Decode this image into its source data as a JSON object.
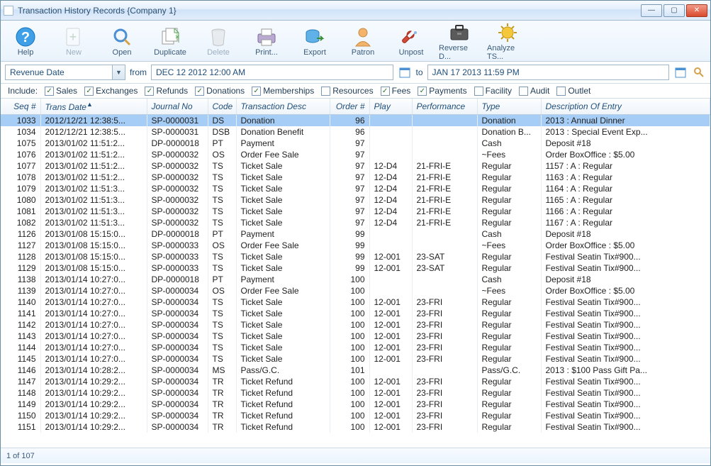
{
  "window": {
    "title": "Transaction History Records {Company 1}"
  },
  "toolbar": {
    "help": "Help",
    "new": "New",
    "open": "Open",
    "duplicate": "Duplicate",
    "delete": "Delete",
    "print": "Print...",
    "export": "Export",
    "patron": "Patron",
    "unpost": "Unpost",
    "reverse": "Reverse D...",
    "analyze": "Analyze TS..."
  },
  "filter": {
    "field": "Revenue Date",
    "from_label": "from",
    "from_value": "DEC 12 2012 12:00 AM",
    "to_label": "to",
    "to_value": "JAN 17 2013 11:59 PM"
  },
  "include": {
    "label": "Include:",
    "sales": "Sales",
    "exchanges": "Exchanges",
    "refunds": "Refunds",
    "donations": "Donations",
    "memberships": "Memberships",
    "resources": "Resources",
    "fees": "Fees",
    "payments": "Payments",
    "facility": "Facility",
    "audit": "Audit",
    "outlet": "Outlet"
  },
  "columns": {
    "seq": "Seq #",
    "trans_date": "Trans Date",
    "journal": "Journal No",
    "code": "Code",
    "desc": "Transaction Desc",
    "order": "Order #",
    "play": "Play",
    "perf": "Performance",
    "type": "Type",
    "entry": "Description Of Entry"
  },
  "status": "1 of 107",
  "rows": [
    {
      "seq": "1033",
      "date": "2012/12/21 12:38:5...",
      "journal": "SP-0000031",
      "code": "DS",
      "desc": "Donation",
      "order": "96",
      "play": "",
      "perf": "",
      "type": "Donation",
      "entry": "2013 : Annual Dinner",
      "selected": true
    },
    {
      "seq": "1034",
      "date": "2012/12/21 12:38:5...",
      "journal": "SP-0000031",
      "code": "DSB",
      "desc": "Donation Benefit",
      "order": "96",
      "play": "",
      "perf": "",
      "type": "Donation B...",
      "entry": "2013 : Special Event Exp..."
    },
    {
      "seq": "1075",
      "date": "2013/01/02 11:51:2...",
      "journal": "DP-0000018",
      "code": "PT",
      "desc": "Payment",
      "order": "97",
      "play": "",
      "perf": "",
      "type": "Cash",
      "entry": "Deposit #18"
    },
    {
      "seq": "1076",
      "date": "2013/01/02 11:51:2...",
      "journal": "SP-0000032",
      "code": "OS",
      "desc": "Order Fee Sale",
      "order": "97",
      "play": "",
      "perf": "",
      "type": "~Fees",
      "entry": "Order BoxOffice : $5.00"
    },
    {
      "seq": "1077",
      "date": "2013/01/02 11:51:2...",
      "journal": "SP-0000032",
      "code": "TS",
      "desc": "Ticket Sale",
      "order": "97",
      "play": "12-D4",
      "perf": "21-FRI-E",
      "type": "Regular",
      "entry": "1157 : A : Regular"
    },
    {
      "seq": "1078",
      "date": "2013/01/02 11:51:2...",
      "journal": "SP-0000032",
      "code": "TS",
      "desc": "Ticket Sale",
      "order": "97",
      "play": "12-D4",
      "perf": "21-FRI-E",
      "type": "Regular",
      "entry": "1163 : A : Regular"
    },
    {
      "seq": "1079",
      "date": "2013/01/02 11:51:3...",
      "journal": "SP-0000032",
      "code": "TS",
      "desc": "Ticket Sale",
      "order": "97",
      "play": "12-D4",
      "perf": "21-FRI-E",
      "type": "Regular",
      "entry": "1164 : A : Regular"
    },
    {
      "seq": "1080",
      "date": "2013/01/02 11:51:3...",
      "journal": "SP-0000032",
      "code": "TS",
      "desc": "Ticket Sale",
      "order": "97",
      "play": "12-D4",
      "perf": "21-FRI-E",
      "type": "Regular",
      "entry": "1165 : A : Regular"
    },
    {
      "seq": "1081",
      "date": "2013/01/02 11:51:3...",
      "journal": "SP-0000032",
      "code": "TS",
      "desc": "Ticket Sale",
      "order": "97",
      "play": "12-D4",
      "perf": "21-FRI-E",
      "type": "Regular",
      "entry": "1166 : A : Regular"
    },
    {
      "seq": "1082",
      "date": "2013/01/02 11:51:3...",
      "journal": "SP-0000032",
      "code": "TS",
      "desc": "Ticket Sale",
      "order": "97",
      "play": "12-D4",
      "perf": "21-FRI-E",
      "type": "Regular",
      "entry": "1167 : A : Regular"
    },
    {
      "seq": "1126",
      "date": "2013/01/08 15:15:0...",
      "journal": "DP-0000018",
      "code": "PT",
      "desc": "Payment",
      "order": "99",
      "play": "",
      "perf": "",
      "type": "Cash",
      "entry": "Deposit #18"
    },
    {
      "seq": "1127",
      "date": "2013/01/08 15:15:0...",
      "journal": "SP-0000033",
      "code": "OS",
      "desc": "Order Fee Sale",
      "order": "99",
      "play": "",
      "perf": "",
      "type": "~Fees",
      "entry": "Order BoxOffice : $5.00"
    },
    {
      "seq": "1128",
      "date": "2013/01/08 15:15:0...",
      "journal": "SP-0000033",
      "code": "TS",
      "desc": "Ticket Sale",
      "order": "99",
      "play": "12-001",
      "perf": "23-SAT",
      "type": "Regular",
      "entry": "Festival Seatin Tix#900..."
    },
    {
      "seq": "1129",
      "date": "2013/01/08 15:15:0...",
      "journal": "SP-0000033",
      "code": "TS",
      "desc": "Ticket Sale",
      "order": "99",
      "play": "12-001",
      "perf": "23-SAT",
      "type": "Regular",
      "entry": "Festival Seatin Tix#900..."
    },
    {
      "seq": "1138",
      "date": "2013/01/14 10:27:0...",
      "journal": "DP-0000018",
      "code": "PT",
      "desc": "Payment",
      "order": "100",
      "play": "",
      "perf": "",
      "type": "Cash",
      "entry": "Deposit #18"
    },
    {
      "seq": "1139",
      "date": "2013/01/14 10:27:0...",
      "journal": "SP-0000034",
      "code": "OS",
      "desc": "Order Fee Sale",
      "order": "100",
      "play": "",
      "perf": "",
      "type": "~Fees",
      "entry": "Order BoxOffice : $5.00"
    },
    {
      "seq": "1140",
      "date": "2013/01/14 10:27:0...",
      "journal": "SP-0000034",
      "code": "TS",
      "desc": "Ticket Sale",
      "order": "100",
      "play": "12-001",
      "perf": "23-FRI",
      "type": "Regular",
      "entry": "Festival Seatin Tix#900..."
    },
    {
      "seq": "1141",
      "date": "2013/01/14 10:27:0...",
      "journal": "SP-0000034",
      "code": "TS",
      "desc": "Ticket Sale",
      "order": "100",
      "play": "12-001",
      "perf": "23-FRI",
      "type": "Regular",
      "entry": "Festival Seatin Tix#900..."
    },
    {
      "seq": "1142",
      "date": "2013/01/14 10:27:0...",
      "journal": "SP-0000034",
      "code": "TS",
      "desc": "Ticket Sale",
      "order": "100",
      "play": "12-001",
      "perf": "23-FRI",
      "type": "Regular",
      "entry": "Festival Seatin Tix#900..."
    },
    {
      "seq": "1143",
      "date": "2013/01/14 10:27:0...",
      "journal": "SP-0000034",
      "code": "TS",
      "desc": "Ticket Sale",
      "order": "100",
      "play": "12-001",
      "perf": "23-FRI",
      "type": "Regular",
      "entry": "Festival Seatin Tix#900..."
    },
    {
      "seq": "1144",
      "date": "2013/01/14 10:27:0...",
      "journal": "SP-0000034",
      "code": "TS",
      "desc": "Ticket Sale",
      "order": "100",
      "play": "12-001",
      "perf": "23-FRI",
      "type": "Regular",
      "entry": "Festival Seatin Tix#900..."
    },
    {
      "seq": "1145",
      "date": "2013/01/14 10:27:0...",
      "journal": "SP-0000034",
      "code": "TS",
      "desc": "Ticket Sale",
      "order": "100",
      "play": "12-001",
      "perf": "23-FRI",
      "type": "Regular",
      "entry": "Festival Seatin Tix#900..."
    },
    {
      "seq": "1146",
      "date": "2013/01/14 10:28:2...",
      "journal": "SP-0000034",
      "code": "MS",
      "desc": "Pass/G.C.",
      "order": "101",
      "play": "",
      "perf": "",
      "type": "Pass/G.C.",
      "entry": "2013 : $100 Pass Gift Pa..."
    },
    {
      "seq": "1147",
      "date": "2013/01/14 10:29:2...",
      "journal": "SP-0000034",
      "code": "TR",
      "desc": "Ticket Refund",
      "order": "100",
      "play": "12-001",
      "perf": "23-FRI",
      "type": "Regular",
      "entry": "Festival Seatin Tix#900..."
    },
    {
      "seq": "1148",
      "date": "2013/01/14 10:29:2...",
      "journal": "SP-0000034",
      "code": "TR",
      "desc": "Ticket Refund",
      "order": "100",
      "play": "12-001",
      "perf": "23-FRI",
      "type": "Regular",
      "entry": "Festival Seatin Tix#900..."
    },
    {
      "seq": "1149",
      "date": "2013/01/14 10:29:2...",
      "journal": "SP-0000034",
      "code": "TR",
      "desc": "Ticket Refund",
      "order": "100",
      "play": "12-001",
      "perf": "23-FRI",
      "type": "Regular",
      "entry": "Festival Seatin Tix#900..."
    },
    {
      "seq": "1150",
      "date": "2013/01/14 10:29:2...",
      "journal": "SP-0000034",
      "code": "TR",
      "desc": "Ticket Refund",
      "order": "100",
      "play": "12-001",
      "perf": "23-FRI",
      "type": "Regular",
      "entry": "Festival Seatin Tix#900..."
    },
    {
      "seq": "1151",
      "date": "2013/01/14 10:29:2...",
      "journal": "SP-0000034",
      "code": "TR",
      "desc": "Ticket Refund",
      "order": "100",
      "play": "12-001",
      "perf": "23-FRI",
      "type": "Regular",
      "entry": "Festival Seatin Tix#900..."
    }
  ]
}
